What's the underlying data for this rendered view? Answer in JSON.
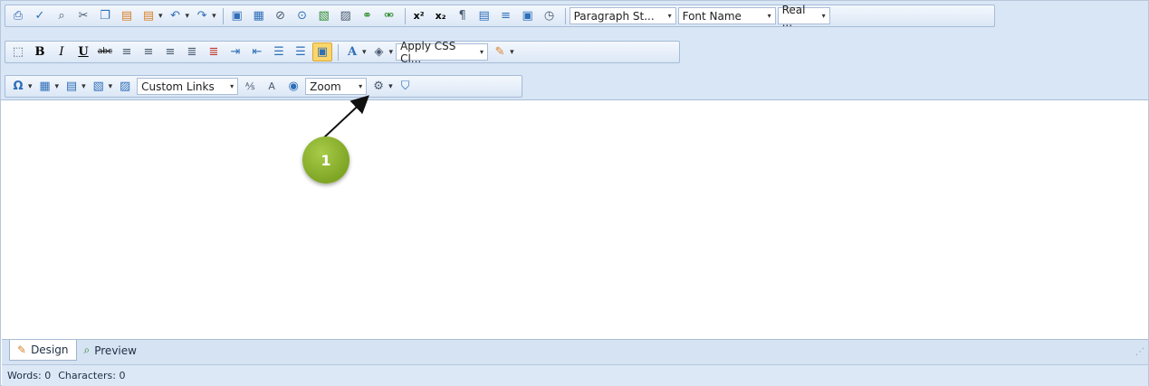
{
  "toolbar": {
    "row1": {
      "icons": [
        "print-icon",
        "spell-check-icon",
        "find-icon",
        "cut-icon",
        "copy-icon",
        "paste-icon",
        "paste-special-icon",
        "undo-icon",
        "redo-icon",
        "image-manager-icon",
        "image-map-icon",
        "flash-manager-icon",
        "media-manager-icon",
        "document-manager-icon",
        "template-manager-icon",
        "insert-link-icon",
        "remove-link-icon",
        "superscript-icon",
        "subscript-icon",
        "paragraph-icon",
        "insert-date-icon",
        "insert-text-icon",
        "format-code-icon",
        "insert-time-icon"
      ],
      "paragraph_style": "Paragraph St...",
      "font_name": "Font Name",
      "font_size": "Real ..."
    },
    "row2": {
      "bold": "B",
      "italic": "I",
      "underline": "U",
      "strike": "abc",
      "font_color": "A",
      "css_class": "Apply CSS Cl..."
    },
    "row3": {
      "special_chars": "Ω",
      "custom_links": "Custom Links",
      "spell_a": "A",
      "zoom": "Zoom"
    }
  },
  "annotation": {
    "number": "1"
  },
  "tabs": [
    {
      "label": "Design",
      "active": true
    },
    {
      "label": "Preview",
      "active": false
    }
  ],
  "status": {
    "words": "Words: 0",
    "characters": "Characters: 0"
  }
}
